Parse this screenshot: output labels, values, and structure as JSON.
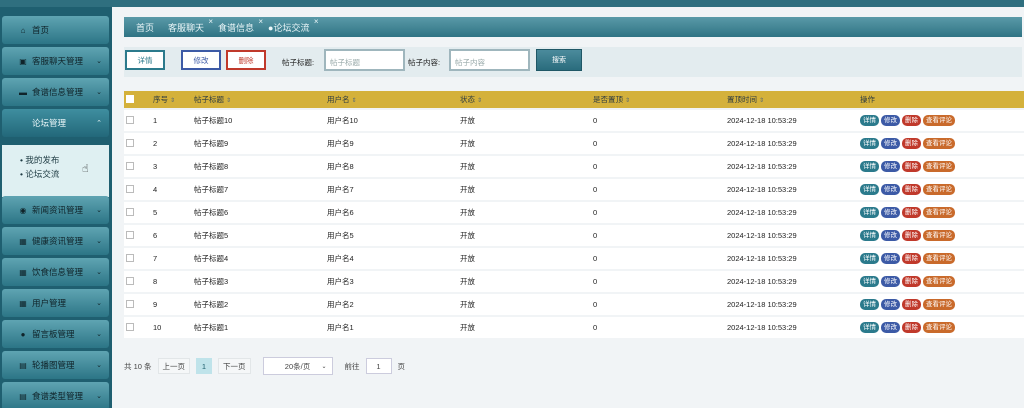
{
  "sidebar": {
    "items": [
      {
        "label": "首页",
        "icon": "home-icon"
      },
      {
        "label": "客服聊天管理",
        "icon": "chat-icon"
      },
      {
        "label": "食谱信息管理",
        "icon": "book-icon"
      },
      {
        "label": "论坛管理",
        "icon": "forum-icon"
      },
      {
        "label": "新闻资讯管理",
        "icon": "globe-icon"
      },
      {
        "label": "健康资讯管理",
        "icon": "grid-icon"
      },
      {
        "label": "饮食信息管理",
        "icon": "grid-icon"
      },
      {
        "label": "用户管理",
        "icon": "grid-icon"
      },
      {
        "label": "留言板管理",
        "icon": "drop-icon"
      },
      {
        "label": "轮播图管理",
        "icon": "image-icon"
      },
      {
        "label": "食谱类型管理",
        "icon": "list-icon"
      }
    ],
    "submenu": [
      "我的发布",
      "论坛交流"
    ]
  },
  "tabs": [
    "首页",
    "客服聊天",
    "食谱信息",
    "论坛交流"
  ],
  "toolbar": {
    "detail": "详情",
    "edit": "修改",
    "delete": "删除",
    "title_label": "帖子标题:",
    "title_placeholder": "帖子标题",
    "content_label": "帖子内容:",
    "content_placeholder": "帖子内容",
    "search": "搜索"
  },
  "table": {
    "headers": [
      "序号",
      "帖子标题",
      "用户名",
      "状态",
      "是否置顶",
      "置顶时间",
      "操作"
    ],
    "rows": [
      {
        "no": "1",
        "title": "帖子标题10",
        "user": "用户名10",
        "status": "开放",
        "top": "0",
        "time": "2024-12-18 10:53:29"
      },
      {
        "no": "2",
        "title": "帖子标题9",
        "user": "用户名9",
        "status": "开放",
        "top": "0",
        "time": "2024-12-18 10:53:29"
      },
      {
        "no": "3",
        "title": "帖子标题8",
        "user": "用户名8",
        "status": "开放",
        "top": "0",
        "time": "2024-12-18 10:53:29"
      },
      {
        "no": "4",
        "title": "帖子标题7",
        "user": "用户名7",
        "status": "开放",
        "top": "0",
        "time": "2024-12-18 10:53:29"
      },
      {
        "no": "5",
        "title": "帖子标题6",
        "user": "用户名6",
        "status": "开放",
        "top": "0",
        "time": "2024-12-18 10:53:29"
      },
      {
        "no": "6",
        "title": "帖子标题5",
        "user": "用户名5",
        "status": "开放",
        "top": "0",
        "time": "2024-12-18 10:53:29"
      },
      {
        "no": "7",
        "title": "帖子标题4",
        "user": "用户名4",
        "status": "开放",
        "top": "0",
        "time": "2024-12-18 10:53:29"
      },
      {
        "no": "8",
        "title": "帖子标题3",
        "user": "用户名3",
        "status": "开放",
        "top": "0",
        "time": "2024-12-18 10:53:29"
      },
      {
        "no": "9",
        "title": "帖子标题2",
        "user": "用户名2",
        "status": "开放",
        "top": "0",
        "time": "2024-12-18 10:53:29"
      },
      {
        "no": "10",
        "title": "帖子标题1",
        "user": "用户名1",
        "status": "开放",
        "top": "0",
        "time": "2024-12-18 10:53:29"
      }
    ],
    "actions": {
      "detail": "详情",
      "edit": "修改",
      "delete": "删除",
      "comments": "查看评论"
    }
  },
  "pager": {
    "total": "共 10 条",
    "prev": "上一页",
    "current": "1",
    "next": "下一页",
    "page_size": "20条/页",
    "goto": "前往",
    "goto_value": "1",
    "page_unit": "页"
  }
}
